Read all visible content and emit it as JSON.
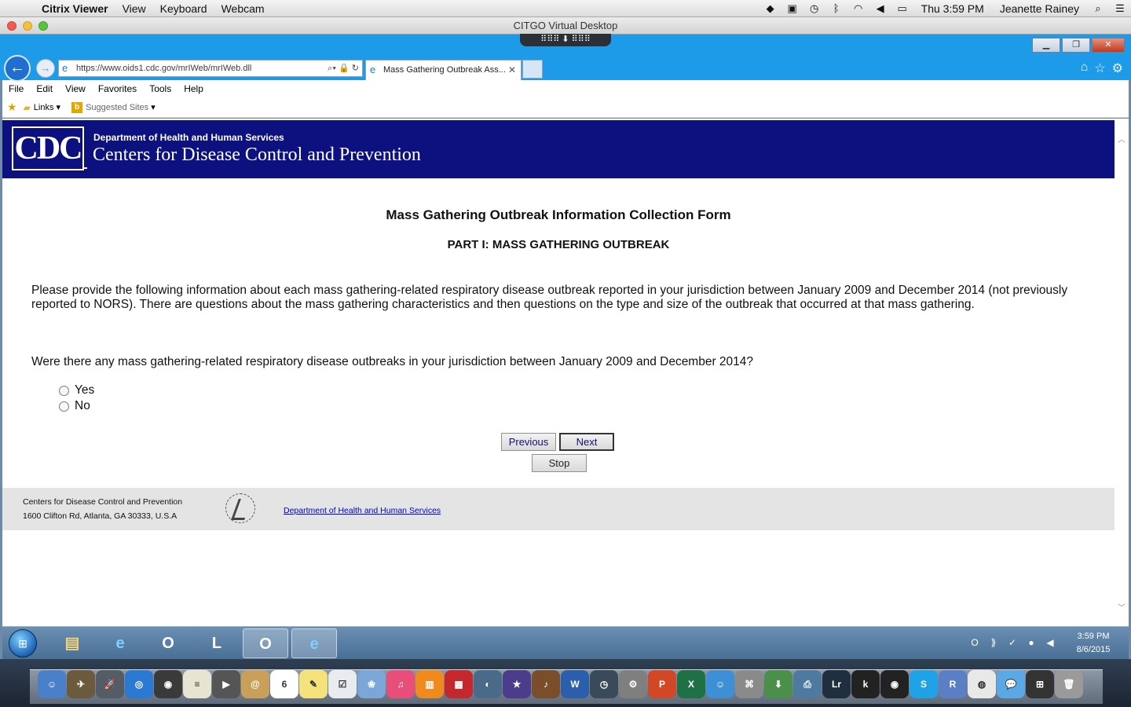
{
  "mac_menubar": {
    "app": "Citrix Viewer",
    "menus": [
      "View",
      "Keyboard",
      "Webcam"
    ],
    "clock": "Thu 3:59 PM",
    "user": "Jeanette Rainey"
  },
  "citrix": {
    "window_title": "CITGO Virtual Desktop"
  },
  "browser": {
    "url": "https://www.oids1.cdc.gov/mrIWeb/mrIWeb.dll",
    "tab_title": "Mass Gathering Outbreak Ass...",
    "menu": [
      "File",
      "Edit",
      "View",
      "Favorites",
      "Tools",
      "Help"
    ],
    "favorites": {
      "links": "Links",
      "suggested": "Suggested Sites"
    }
  },
  "page": {
    "dept": "Department of Health and Human Services",
    "org_name": "Centers for Disease Control and Prevention",
    "logo_text": "CDC",
    "form_title": "Mass Gathering Outbreak Information Collection Form",
    "part_title": "PART I: MASS GATHERING OUTBREAK",
    "intro": "Please provide the following information about each mass gathering-related respiratory disease outbreak reported in your jurisdiction between January 2009 and December 2014 (not previously reported to NORS). There are questions about the mass gathering characteristics and then questions on the type and size of the outbreak that occurred at that mass gathering.",
    "question": "Were there any mass gathering-related respiratory disease outbreaks in your jurisdiction between January 2009 and December 2014?",
    "options": {
      "yes": "Yes",
      "no": "No"
    },
    "buttons": {
      "previous": "Previous",
      "next": "Next",
      "stop": "Stop"
    },
    "footer": {
      "line1": "Centers for Disease Control and Prevention",
      "line2": "1600 Clifton Rd, Atlanta, GA 30333, U.S.A",
      "link": "Department of Health and Human Services"
    }
  },
  "taskbar": {
    "time": "3:59 PM",
    "date": "8/6/2015"
  }
}
